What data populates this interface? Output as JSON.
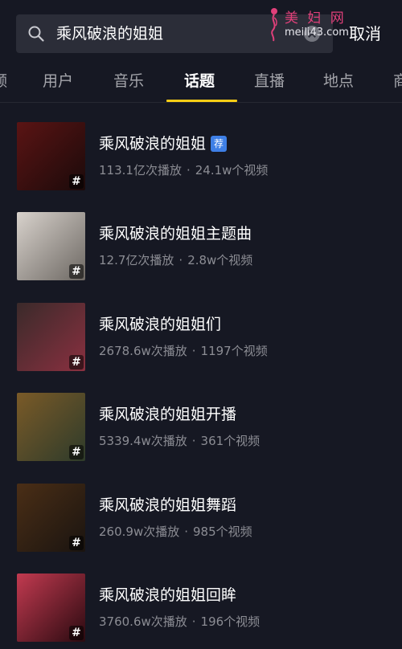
{
  "header": {
    "search_value": "乘风破浪的姐姐",
    "cancel_label": "取消",
    "icons": {
      "search": "search-icon",
      "clear": "clear-icon"
    }
  },
  "watermark": {
    "title": "美 妇 网",
    "url": "meili43.com"
  },
  "tabs": [
    {
      "label": "频"
    },
    {
      "label": "用户"
    },
    {
      "label": "音乐"
    },
    {
      "label": "话题",
      "active": true
    },
    {
      "label": "直播"
    },
    {
      "label": "地点"
    },
    {
      "label": "商"
    }
  ],
  "topics": [
    {
      "title": "乘风破浪的姐姐",
      "badge": "荐",
      "plays": "113.1亿次播放",
      "videos": "24.1w个视频",
      "thumb_colors": [
        "#5a1414",
        "#1b0a0a"
      ]
    },
    {
      "title": "乘风破浪的姐姐主题曲",
      "plays": "12.7亿次播放",
      "videos": "2.8w个视频",
      "thumb_colors": [
        "#d8d2cc",
        "#6d6863"
      ]
    },
    {
      "title": "乘风破浪的姐姐们",
      "plays": "2678.6w次播放",
      "videos": "1197个视频",
      "thumb_colors": [
        "#3a2a2a",
        "#8a3040"
      ]
    },
    {
      "title": "乘风破浪的姐姐开播",
      "plays": "5339.4w次播放",
      "videos": "361个视频",
      "thumb_colors": [
        "#7a5a28",
        "#2e3b2a"
      ]
    },
    {
      "title": "乘风破浪的姐姐舞蹈",
      "plays": "260.9w次播放",
      "videos": "985个视频",
      "thumb_colors": [
        "#4a2e16",
        "#1a1410"
      ]
    },
    {
      "title": "乘风破浪的姐姐回眸",
      "plays": "3760.6w次播放",
      "videos": "196个视频",
      "thumb_colors": [
        "#c23a50",
        "#2a0a10"
      ]
    }
  ],
  "hash_symbol": "#",
  "stats_separator": "·",
  "colors": {
    "background": "#161823",
    "search_bg": "#2b2d38",
    "tab_active_underline": "#face15",
    "recommend_badge": "#3e7fe6",
    "secondary_text": "#8c8d94"
  }
}
